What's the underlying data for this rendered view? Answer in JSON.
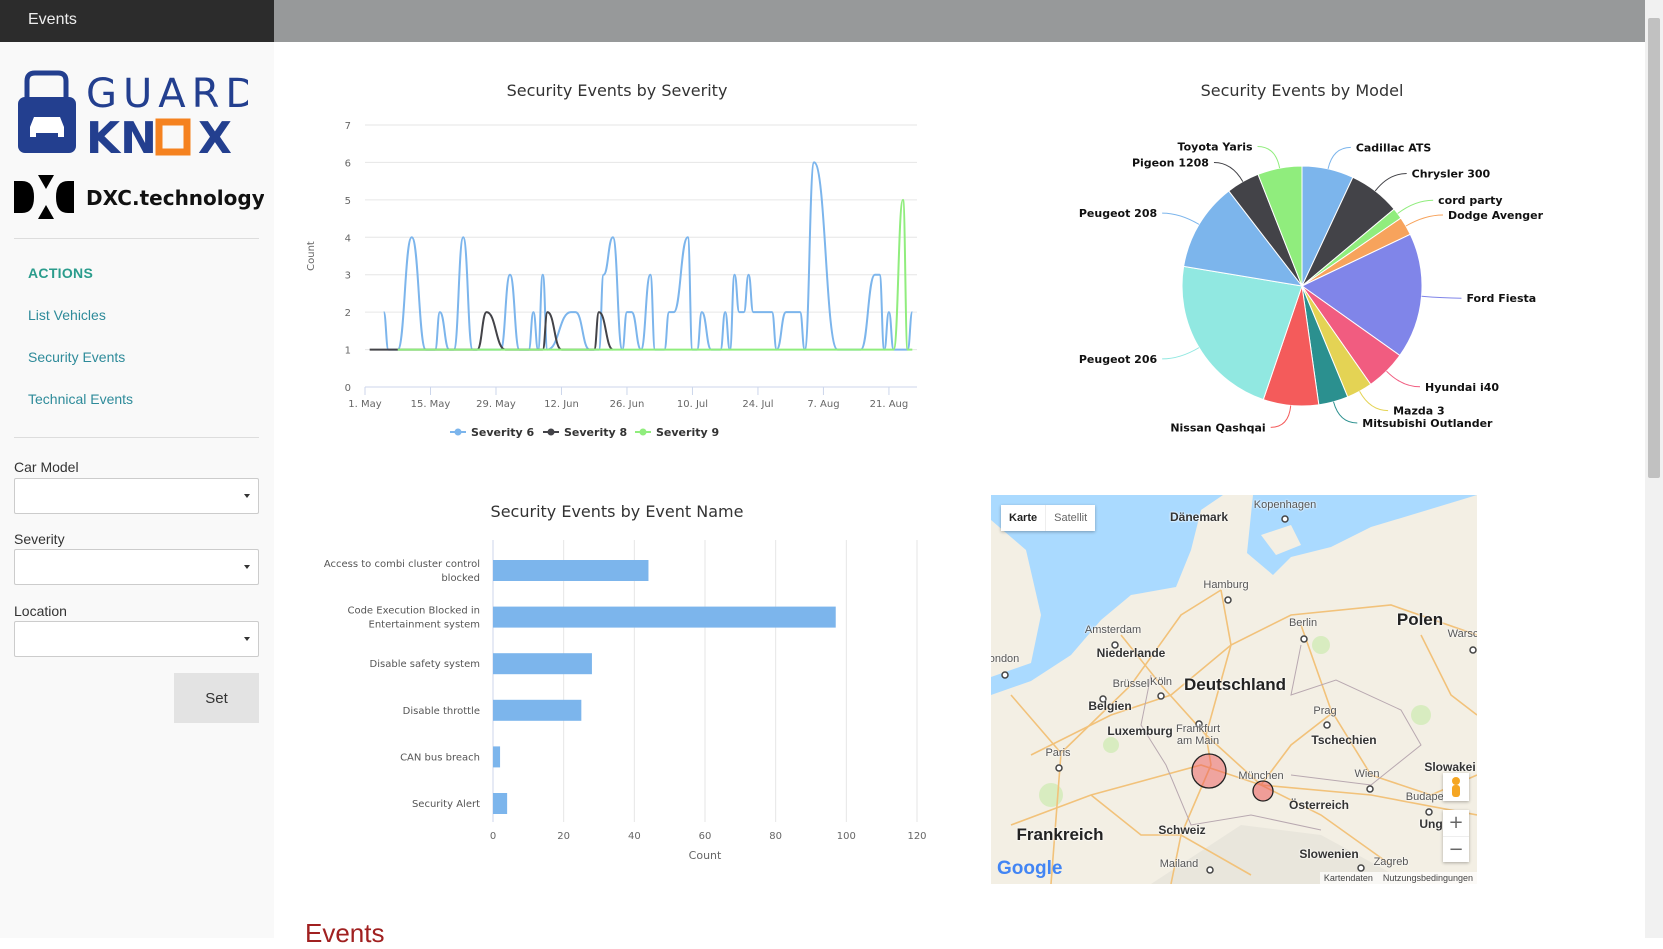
{
  "header": {
    "tab": "Events"
  },
  "brand": {
    "logo_text": "GUARDKNOX",
    "partner": "DXC.technology",
    "colors": {
      "blue": "#233f8f",
      "orange": "#f58220"
    }
  },
  "sidebar": {
    "section": "ACTIONS",
    "items": [
      {
        "label": "List Vehicles"
      },
      {
        "label": "Security Events"
      },
      {
        "label": "Technical Events"
      }
    ],
    "filters": {
      "car_model_label": "Car Model",
      "car_model_value": "",
      "severity_label": "Severity",
      "severity_value": "",
      "location_label": "Location",
      "location_value": ""
    },
    "set_label": "Set"
  },
  "chart_data": [
    {
      "type": "line",
      "title": "Security Events by Severity",
      "ylabel": "Count",
      "ylim": [
        0,
        7
      ],
      "yticks": [
        0,
        1,
        2,
        3,
        4,
        5,
        6,
        7
      ],
      "xlim": [
        "05-01",
        "08-27"
      ],
      "xticks": [
        "1. May",
        "15. May",
        "29. May",
        "12. Jun",
        "26. Jun",
        "10. Jul",
        "24. Jul",
        "7. Aug",
        "21. Aug"
      ],
      "grid": true,
      "legend": "bottom",
      "series": [
        {
          "name": "Severity 6",
          "color": "#7cb5ec",
          "points": [
            [
              "05-05",
              2
            ],
            [
              "05-06",
              1
            ],
            [
              "05-08",
              1
            ],
            [
              "05-11",
              4
            ],
            [
              "05-14",
              1
            ],
            [
              "05-16",
              1
            ],
            [
              "05-17",
              2
            ],
            [
              "05-19",
              1
            ],
            [
              "05-20",
              1
            ],
            [
              "05-22",
              4
            ],
            [
              "05-24",
              1
            ],
            [
              "05-30",
              1
            ],
            [
              "06-01",
              3
            ],
            [
              "06-03",
              1
            ],
            [
              "06-05",
              1
            ],
            [
              "06-06",
              2
            ],
            [
              "06-07",
              1
            ],
            [
              "06-08",
              3
            ],
            [
              "06-09",
              1
            ],
            [
              "06-14",
              2
            ],
            [
              "06-15",
              2
            ],
            [
              "06-18",
              1
            ],
            [
              "06-20",
              1
            ],
            [
              "06-21",
              3
            ],
            [
              "06-23",
              4
            ],
            [
              "06-25",
              1
            ],
            [
              "06-26",
              2
            ],
            [
              "06-27",
              2
            ],
            [
              "06-29",
              1
            ],
            [
              "07-01",
              3
            ],
            [
              "07-02",
              1
            ],
            [
              "07-04",
              1
            ],
            [
              "07-05",
              2
            ],
            [
              "07-06",
              2
            ],
            [
              "07-09",
              4
            ],
            [
              "07-10",
              1
            ],
            [
              "07-11",
              1
            ],
            [
              "07-12",
              2
            ],
            [
              "07-14",
              1
            ],
            [
              "07-16",
              1
            ],
            [
              "07-17",
              2
            ],
            [
              "07-18",
              1
            ],
            [
              "07-19",
              3
            ],
            [
              "07-20",
              2
            ],
            [
              "07-21",
              2
            ],
            [
              "07-22",
              3
            ],
            [
              "07-23",
              2
            ],
            [
              "07-27",
              2
            ],
            [
              "07-28",
              1
            ],
            [
              "07-30",
              2
            ],
            [
              "08-02",
              2
            ],
            [
              "08-03",
              1
            ],
            [
              "08-05",
              6
            ],
            [
              "08-10",
              1
            ],
            [
              "08-15",
              1
            ],
            [
              "08-18",
              3
            ],
            [
              "08-19",
              3
            ],
            [
              "08-20",
              1
            ],
            [
              "08-21",
              2
            ],
            [
              "08-22",
              1
            ],
            [
              "08-25",
              1
            ],
            [
              "08-26",
              2
            ]
          ]
        },
        {
          "name": "Severity 8",
          "color": "#434348",
          "points": [
            [
              "05-02",
              1
            ],
            [
              "05-08",
              1
            ],
            [
              "05-25",
              1
            ],
            [
              "05-27",
              2
            ],
            [
              "05-31",
              1
            ],
            [
              "06-08",
              1
            ],
            [
              "06-09",
              2
            ],
            [
              "06-12",
              1
            ],
            [
              "06-19",
              1
            ],
            [
              "06-20",
              2
            ],
            [
              "06-23",
              1
            ]
          ]
        },
        {
          "name": "Severity 9",
          "color": "#90ed7d",
          "points": [
            [
              "05-08",
              1
            ],
            [
              "08-21",
              1
            ],
            [
              "08-22",
              1
            ],
            [
              "08-24",
              5
            ],
            [
              "08-25",
              1
            ],
            [
              "08-26",
              1
            ]
          ]
        }
      ]
    },
    {
      "type": "pie",
      "title": "Security Events by Model",
      "slices": [
        {
          "label": "Cadillac ATS",
          "value": 7,
          "color": "#7cb5ec"
        },
        {
          "label": "Chrysler 300",
          "value": 7,
          "color": "#434348"
        },
        {
          "label": "cord party",
          "value": 1.5,
          "color": "#90ed7d"
        },
        {
          "label": "Dodge Avenger",
          "value": 2.5,
          "color": "#f7a35c"
        },
        {
          "label": "Ford Fiesta",
          "value": 17,
          "color": "#8085e9"
        },
        {
          "label": "Hyundai i40",
          "value": 5.5,
          "color": "#f15c80"
        },
        {
          "label": "Mazda 3",
          "value": 3.5,
          "color": "#e4d354"
        },
        {
          "label": "Mitsubishi Outlander",
          "value": 4,
          "color": "#2b908f"
        },
        {
          "label": "Nissan Qashqai",
          "value": 7.5,
          "color": "#f45b5b"
        },
        {
          "label": "Peugeot 206",
          "value": 22.5,
          "color": "#91e8e1"
        },
        {
          "label": "Peugeot 208",
          "value": 12,
          "color": "#7cb5ec"
        },
        {
          "label": "Pigeon 1208",
          "value": 4.5,
          "color": "#434348"
        },
        {
          "label": "Toyota Yaris",
          "value": 6,
          "color": "#90ed7d"
        }
      ]
    },
    {
      "type": "bar",
      "title": "Security Events by Event Name",
      "xlabel": "Count",
      "xlim": [
        0,
        120
      ],
      "xticks": [
        0,
        20,
        40,
        60,
        80,
        100,
        120
      ],
      "grid": true,
      "color": "#7cb5ec",
      "categories": [
        [
          "Access to combi cluster control",
          "blocked"
        ],
        [
          "Code Execution Blocked in",
          "Entertainment system"
        ],
        [
          "Disable safety system"
        ],
        [
          "Disable throttle"
        ],
        [
          "CAN bus breach"
        ],
        [
          "Security Alert"
        ]
      ],
      "values": [
        44,
        97,
        28,
        25,
        2,
        4
      ]
    }
  ],
  "map": {
    "type_buttons": [
      "Karte",
      "Satellit"
    ],
    "labels": [
      {
        "t": "Kopenhagen",
        "c": ""
      },
      {
        "t": "Dänemark",
        "c": "country"
      },
      {
        "t": "Hamburg",
        "c": ""
      },
      {
        "t": "Polen",
        "c": "big"
      },
      {
        "t": "Warsc",
        "c": ""
      },
      {
        "t": "Berlin",
        "c": ""
      },
      {
        "t": "Amsterdam",
        "c": ""
      },
      {
        "t": "Niederlande",
        "c": "country"
      },
      {
        "t": "ondon",
        "c": ""
      },
      {
        "t": "Brüssel",
        "c": ""
      },
      {
        "t": "Köln",
        "c": ""
      },
      {
        "t": "Deutschland",
        "c": "big"
      },
      {
        "t": "Belgien",
        "c": "country"
      },
      {
        "t": "Prag",
        "c": ""
      },
      {
        "t": "Luxemburg",
        "c": "country"
      },
      {
        "t": "Frankfurt\nam Main",
        "c": ""
      },
      {
        "t": "Tschechien",
        "c": "country"
      },
      {
        "t": "Paris",
        "c": ""
      },
      {
        "t": "Slowakei",
        "c": "country"
      },
      {
        "t": "München",
        "c": ""
      },
      {
        "t": "Wien",
        "c": ""
      },
      {
        "t": "Budapest",
        "c": ""
      },
      {
        "t": "Österreich",
        "c": "country"
      },
      {
        "t": "Ung",
        "c": "country"
      },
      {
        "t": "Schweiz",
        "c": "country"
      },
      {
        "t": "Frankreich",
        "c": "big"
      },
      {
        "t": "Slowenien",
        "c": "country"
      },
      {
        "t": "Zagreb",
        "c": ""
      },
      {
        "t": "Mailand",
        "c": ""
      }
    ],
    "attribution": [
      "Kartendaten",
      "Nutzungsbedingungen"
    ],
    "zoom_in": "+",
    "zoom_out": "−",
    "provider": "Google"
  },
  "section_heading": "Events"
}
